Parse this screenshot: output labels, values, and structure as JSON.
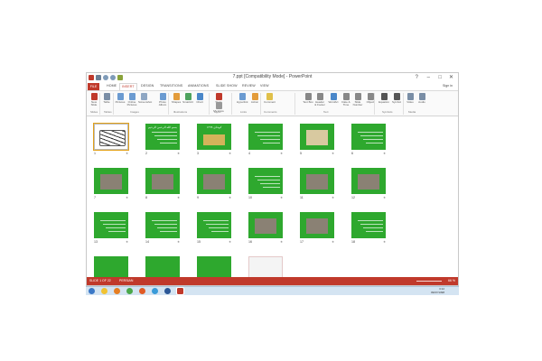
{
  "window": {
    "title": "7.ppt [Compatibility Mode] - PowerPoint",
    "controls": [
      "?",
      "–",
      "□",
      "✕"
    ]
  },
  "tabs": [
    "HOME",
    "INSERT",
    "DESIGN",
    "TRANSITIONS",
    "ANIMATIONS",
    "SLIDE SHOW",
    "REVIEW",
    "VIEW"
  ],
  "file_tab": "FILE",
  "active_tab": "INSERT",
  "signin": "Sign in",
  "ribbon": {
    "buttons": [
      {
        "label": "New Slide",
        "icon": "new-slide-icon",
        "color": "#c0392b"
      },
      {
        "label": "Table",
        "icon": "table-icon",
        "color": "#7a8ea6"
      },
      {
        "label": "Pictures",
        "icon": "pictures-icon",
        "color": "#6b9bd1"
      },
      {
        "label": "Online Pictures",
        "icon": "online-pictures-icon",
        "color": "#6b9bd1"
      },
      {
        "label": "Screenshot",
        "icon": "screenshot-icon",
        "color": "#8fa7c3"
      },
      {
        "label": "Photo Album",
        "icon": "photo-album-icon",
        "color": "#6b9bd1"
      },
      {
        "label": "Shapes",
        "icon": "shapes-icon",
        "color": "#e39c3b"
      },
      {
        "label": "SmartArt",
        "icon": "smartart-icon",
        "color": "#4ea35e"
      },
      {
        "label": "Chart",
        "icon": "chart-icon",
        "color": "#4a87c9"
      },
      {
        "label": "Store",
        "icon": "store-icon",
        "color": "#c0392b"
      },
      {
        "label": "My Apps",
        "icon": "my-apps-icon",
        "color": "#999999"
      },
      {
        "label": "Hyperlink",
        "icon": "hyperlink-icon",
        "color": "#6b9bd1"
      },
      {
        "label": "Action",
        "icon": "action-icon",
        "color": "#e39c3b"
      },
      {
        "label": "Comment",
        "icon": "comment-icon",
        "color": "#e0c04a"
      },
      {
        "label": "Text Box",
        "icon": "text-box-icon",
        "color": "#888888"
      },
      {
        "label": "Header & Footer",
        "icon": "header-footer-icon",
        "color": "#888888"
      },
      {
        "label": "WordArt",
        "icon": "wordart-icon",
        "color": "#4a87c9"
      },
      {
        "label": "Date & Time",
        "icon": "date-time-icon",
        "color": "#888888"
      },
      {
        "label": "Slide Number",
        "icon": "slide-number-icon",
        "color": "#888888"
      },
      {
        "label": "Object",
        "icon": "object-icon",
        "color": "#888888"
      },
      {
        "label": "Equation",
        "icon": "equation-icon",
        "color": "#555555"
      },
      {
        "label": "Symbol",
        "icon": "symbol-icon",
        "color": "#555555"
      },
      {
        "label": "Video",
        "icon": "video-icon",
        "color": "#7a8ea6"
      },
      {
        "label": "Audio",
        "icon": "audio-icon",
        "color": "#7a8ea6"
      }
    ],
    "groups": [
      "Slides",
      "Tables",
      "Images",
      "Illustrations",
      "Apps",
      "Links",
      "Comments",
      "Text",
      "Symbols",
      "Media"
    ]
  },
  "slides": [
    {
      "num": "1",
      "title": "",
      "kind": "white"
    },
    {
      "num": "2",
      "title": "بسم الله الرحمن الرحیم",
      "kind": "green"
    },
    {
      "num": "3",
      "title": "کودتای ۱۲۹۹",
      "kind": "green-photo"
    },
    {
      "num": "4",
      "title": "",
      "kind": "green"
    },
    {
      "num": "5",
      "title": "",
      "kind": "map"
    },
    {
      "num": "6",
      "title": "",
      "kind": "green"
    },
    {
      "num": "7",
      "title": "",
      "kind": "photo"
    },
    {
      "num": "8",
      "title": "",
      "kind": "photo"
    },
    {
      "num": "9",
      "title": "",
      "kind": "photo"
    },
    {
      "num": "10",
      "title": "",
      "kind": "green"
    },
    {
      "num": "11",
      "title": "",
      "kind": "photo"
    },
    {
      "num": "12",
      "title": "",
      "kind": "photo"
    },
    {
      "num": "13",
      "title": "",
      "kind": "green"
    },
    {
      "num": "14",
      "title": "",
      "kind": "green"
    },
    {
      "num": "15",
      "title": "",
      "kind": "green"
    },
    {
      "num": "16",
      "title": "",
      "kind": "photo"
    },
    {
      "num": "17",
      "title": "",
      "kind": "photo"
    },
    {
      "num": "18",
      "title": "",
      "kind": "green"
    }
  ],
  "status": {
    "slide": "SLIDE 1 OF 22",
    "language": "PERSIAN",
    "zoom": "66 %"
  },
  "taskbar_icons": [
    "start-icon",
    "explorer-icon",
    "media-icon",
    "chrome-icon",
    "firefox-icon",
    "skype-icon",
    "word-icon",
    "powerpoint-icon"
  ],
  "clock": {
    "time": "3:12",
    "date": "09/07/1398"
  },
  "colors": {
    "slide_green": "#2ea82e",
    "accent": "#c0392b"
  }
}
